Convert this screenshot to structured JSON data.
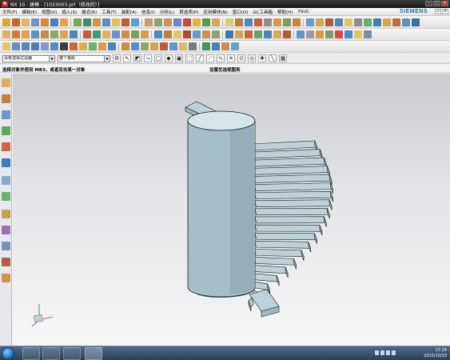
{
  "window": {
    "title": "NX 10 - 建模 - [1023003.prt（修改的）]",
    "controls": [
      "minimize-icon",
      "maximize-icon",
      "close-icon"
    ]
  },
  "menubar": {
    "items": [
      "文件(F)",
      "编辑(E)",
      "视图(V)",
      "插入(S)",
      "格式(R)",
      "工具(T)",
      "装配(A)",
      "信息(I)",
      "分析(L)",
      "首选项(P)",
      "应用模块(N)",
      "窗口(O)",
      "GC工具箱",
      "帮助(H)",
      "YSUC"
    ],
    "brand": "SIEMENS"
  },
  "selection_bar": {
    "type_filter": "没有选择过滤器",
    "scope": "整个装配"
  },
  "cue_line": {
    "cue": "选择对象并使用 MB3，或者双击某一对象",
    "status": "设置优选视图到"
  },
  "taskbar": {
    "time": "17:24",
    "date": "2015/10/23"
  },
  "colors": {
    "solid_fill": "#bcd2d8",
    "solid_edge": "#14191c",
    "cylinder_top": "#d4e6ec",
    "cylinder_body": "#a6bec5",
    "viewport_top": "#c9cbcf",
    "viewport_bottom": "#f6f6f7",
    "title_bar": "#262626",
    "siemens_brand": "#1b6a8f"
  }
}
